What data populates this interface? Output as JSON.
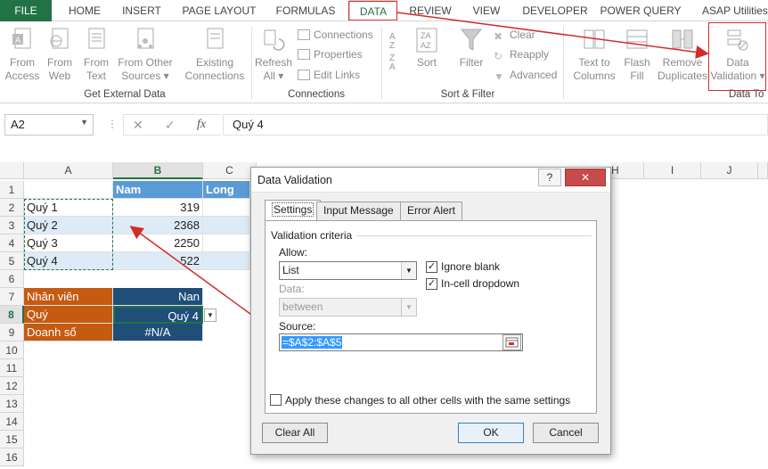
{
  "tabs": [
    "FILE",
    "HOME",
    "INSERT",
    "PAGE LAYOUT",
    "FORMULAS",
    "DATA",
    "REVIEW",
    "VIEW",
    "DEVELOPER",
    "POWER QUERY",
    "ASAP Utilities"
  ],
  "active_tab": "DATA",
  "ribbon": {
    "external": {
      "from_access": [
        "From",
        "Access"
      ],
      "from_web": [
        "From",
        "Web"
      ],
      "from_text": [
        "From",
        "Text"
      ],
      "from_other": [
        "From Other",
        "Sources ▾"
      ],
      "existing": [
        "Existing",
        "Connections"
      ],
      "label": "Get External Data"
    },
    "connections": {
      "refresh": [
        "Refresh",
        "All ▾"
      ],
      "connections": "Connections",
      "properties": "Properties",
      "edit_links": "Edit Links",
      "label": "Connections"
    },
    "sort": {
      "sort": "Sort",
      "filter": "Filter",
      "clear": "Clear",
      "reapply": "Reapply",
      "advanced": "Advanced",
      "label": "Sort & Filter"
    },
    "tools": {
      "text_to_columns": [
        "Text to",
        "Columns"
      ],
      "flash_fill": [
        "Flash",
        "Fill"
      ],
      "remove_duplicates": [
        "Remove",
        "Duplicates"
      ],
      "data_validation": [
        "Data",
        "Validation ▾"
      ],
      "label": "Data To"
    }
  },
  "formula_bar": {
    "name_box": "A2",
    "fx": "fx",
    "value": "Quý 4"
  },
  "columns": [
    "A",
    "B",
    "C",
    "H",
    "I",
    "J"
  ],
  "rows": [
    "1",
    "2",
    "3",
    "4",
    "5",
    "6",
    "7",
    "8",
    "9",
    "10",
    "11",
    "12",
    "13",
    "14",
    "15",
    "16"
  ],
  "cells": {
    "b1": "Nam",
    "c1": "Long",
    "a2": "Quý 1",
    "b2": "319",
    "a3": "Quý 2",
    "b3": "2368",
    "a4": "Quý 3",
    "b4": "2250",
    "a5": "Quý 4",
    "b5": "522",
    "a7": "Nhân viên",
    "b7": "Nan",
    "a8": "Quý",
    "b8": "Quý 4",
    "a9": "Doanh số",
    "b9": "#N/A"
  },
  "colors": {
    "excel_green": "#217346",
    "header_blue": "#5b9bd5",
    "band_blue": "#ddebf7",
    "label_orange": "#c55a11",
    "value_navy": "#1f4e79",
    "highlight_red": "#d52b2b"
  },
  "dialog": {
    "title": "Data Validation",
    "help": "?",
    "close": "✕",
    "tabs": [
      "Settings",
      "Input Message",
      "Error Alert"
    ],
    "criteria_label": "Validation criteria",
    "allow_label": "Allow:",
    "allow_value": "List",
    "ignore_blank": "Ignore blank",
    "in_cell_dropdown": "In-cell dropdown",
    "data_label": "Data:",
    "data_value": "between",
    "source_label": "Source:",
    "source_value": "=$A$2:$A$5",
    "apply_all": "Apply these changes to all other cells with the same settings",
    "clear_all": "Clear All",
    "ok": "OK",
    "cancel": "Cancel"
  }
}
